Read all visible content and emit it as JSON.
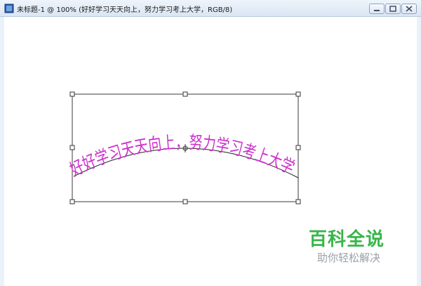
{
  "window": {
    "title": "未标题-1 @ 100% (好好学习天天向上，努力学习考上大学，RGB/8)",
    "icon": "document-icon",
    "buttons": {
      "minimize": "minimize-icon",
      "maximize": "maximize-icon",
      "close": "close-icon"
    }
  },
  "canvas": {
    "warped_text": "好好学习天天向上，努力学习考上大学",
    "text_color": "#cc33cc",
    "background": "#ffffff"
  },
  "watermark": {
    "title": "百科全说",
    "subtitle": "助你轻松解决",
    "title_color": "#39b54a",
    "subtitle_color": "#9aa0a6"
  }
}
